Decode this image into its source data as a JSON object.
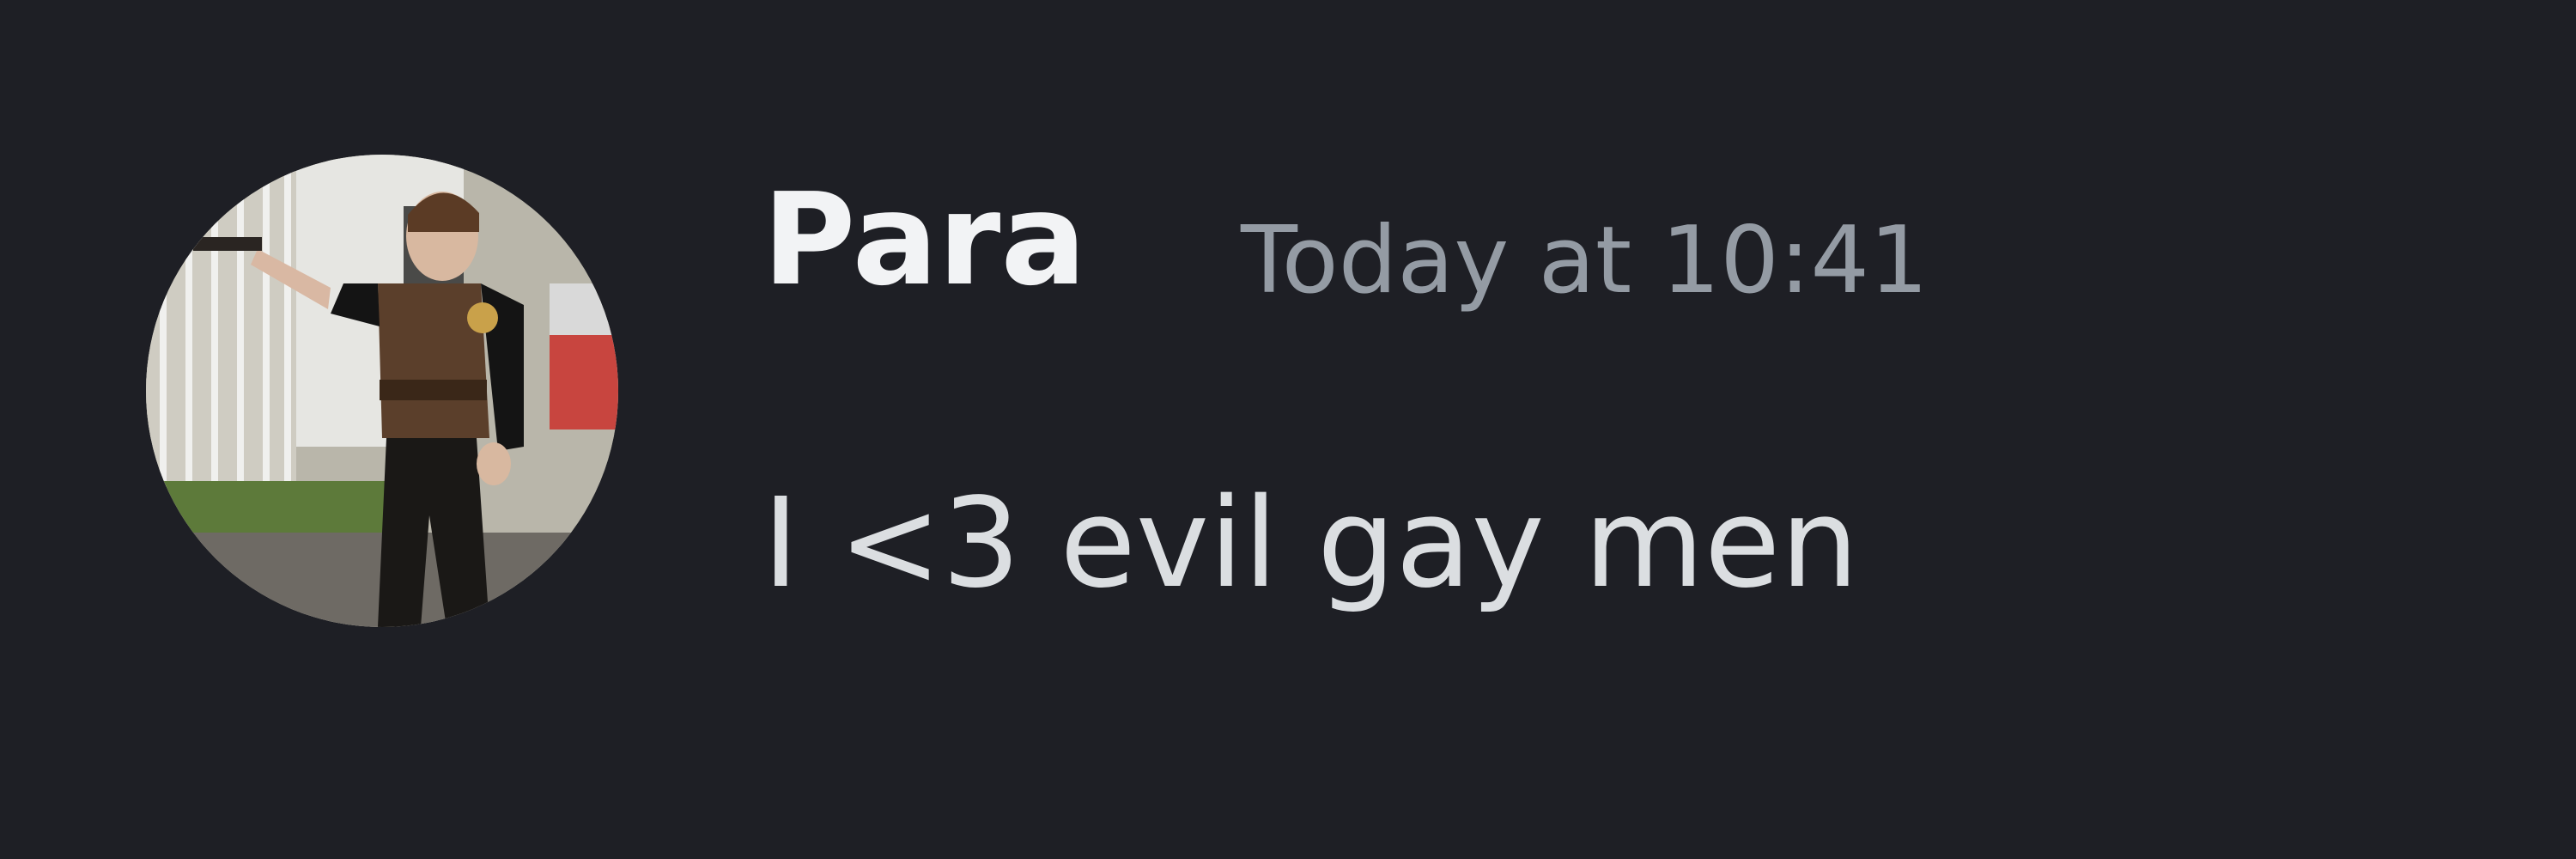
{
  "message": {
    "author": "Para",
    "timestamp": "Today at 10:41",
    "content": "I <3 evil gay men"
  },
  "colors": {
    "background": "#1e1f25",
    "username": "#f2f3f5",
    "timestamp": "#949ba4",
    "content": "#dbdee1"
  }
}
